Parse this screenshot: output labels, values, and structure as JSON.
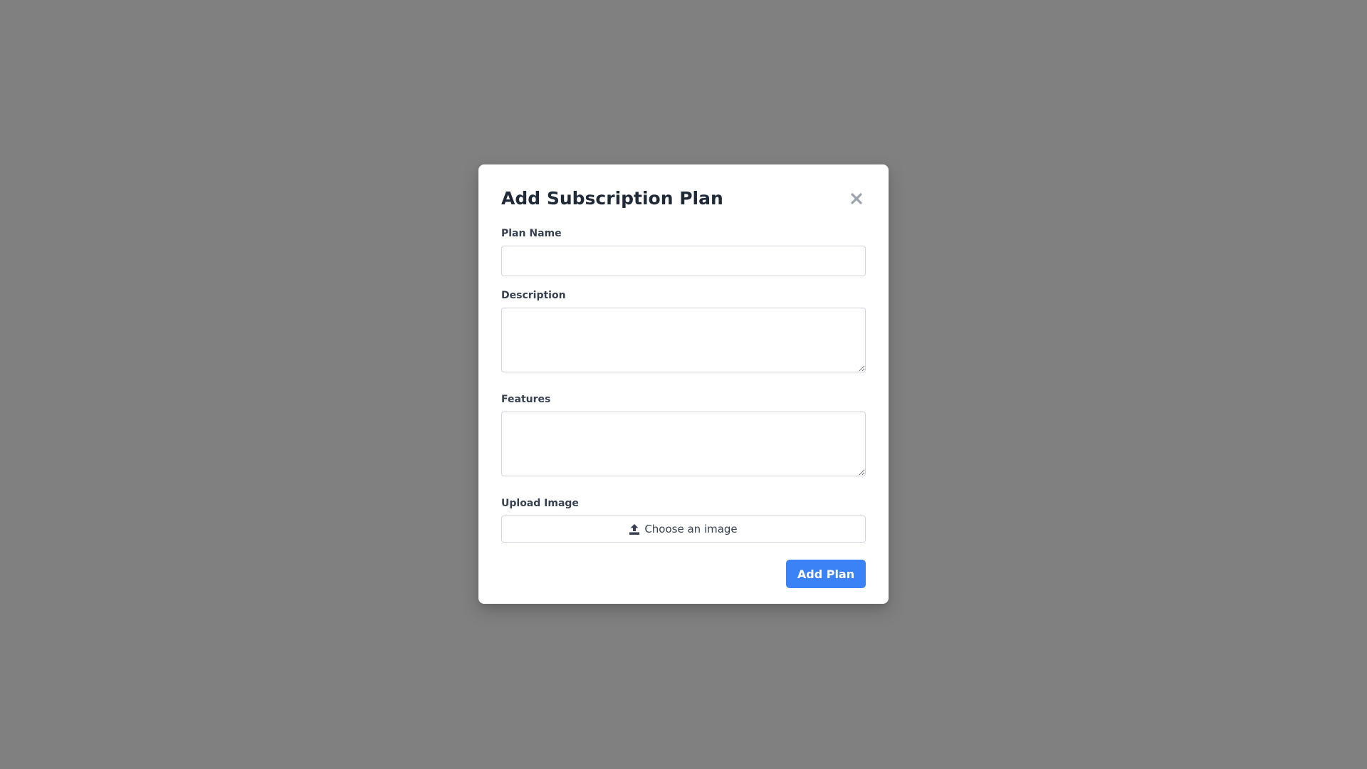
{
  "modal": {
    "title": "Add Subscription Plan",
    "close_icon": "close-icon"
  },
  "form": {
    "plan_name": {
      "label": "Plan Name",
      "value": "",
      "placeholder": ""
    },
    "description": {
      "label": "Description",
      "value": "",
      "placeholder": ""
    },
    "features": {
      "label": "Features",
      "value": "",
      "placeholder": ""
    },
    "upload_image": {
      "label": "Upload Image",
      "button_text": "Choose an image",
      "icon": "upload-icon"
    }
  },
  "footer": {
    "submit_label": "Add Plan"
  },
  "colors": {
    "backdrop": "#808080",
    "accent": "#3b82f6",
    "title_text": "#1f2937",
    "label_text": "#374151",
    "close_icon": "#9ca3af"
  }
}
